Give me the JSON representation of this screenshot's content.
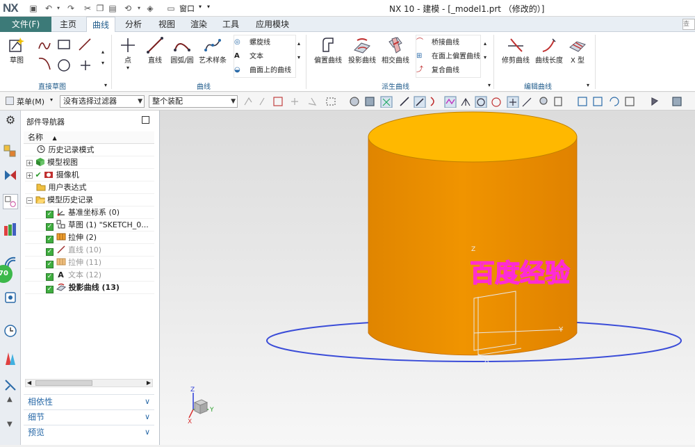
{
  "titlebar": {
    "logo": "NX",
    "window_title": "NX 10 - 建模 - [_model1.prt （修改的）]",
    "window_menu_label": "窗口"
  },
  "menubar": {
    "file_tab": "文件(F)",
    "tabs": [
      "主页",
      "曲线",
      "分析",
      "视图",
      "渲染",
      "工具",
      "应用模块"
    ],
    "active_tab": "曲线",
    "search_placeholder": "查找命令"
  },
  "ribbon": {
    "sketch_label": "草图",
    "direct_sketch_group": "直接草图",
    "curve_group": "曲线",
    "derived_curve_group": "派生曲线",
    "edit_curve_group": "编辑曲线",
    "curve_buttons": [
      "点",
      "直线",
      "圆弧/圆",
      "艺术样条"
    ],
    "curve_list": [
      "螺旋线",
      "文本",
      "曲面上的曲线"
    ],
    "derived_buttons": [
      "偏置曲线",
      "投影曲线",
      "相交曲线"
    ],
    "derived_list": [
      "桥接曲线",
      "在面上偏置曲线",
      "复合曲线"
    ],
    "edit_buttons": [
      "修剪曲线",
      "曲线长度",
      "X 型"
    ]
  },
  "toolbar": {
    "menu_label": "菜单(M)",
    "filter_value": "没有选择过滤器",
    "assembly_value": "整个装配"
  },
  "navigator": {
    "title": "部件导航器",
    "column_name": "名称",
    "items": [
      {
        "label": "历史记录模式"
      },
      {
        "label": "模型视图"
      },
      {
        "label": "摄像机"
      },
      {
        "label": "用户表达式"
      },
      {
        "label": "模型历史记录"
      },
      {
        "label": "基准坐标系 (0)"
      },
      {
        "label": "草图 (1) \"SKETCH_0..."
      },
      {
        "label": "拉伸 (2)"
      },
      {
        "label": "直线 (10)"
      },
      {
        "label": "拉伸 (11)"
      },
      {
        "label": "文本 (12)"
      },
      {
        "label": "投影曲线 (13)"
      }
    ],
    "sections": [
      "相依性",
      "细节",
      "预览"
    ]
  },
  "left_strip": {
    "badge": "70"
  },
  "viewport": {
    "embossed_text": "百度经验",
    "axis_labels": {
      "x": "X",
      "y": "Y",
      "z": "Z"
    },
    "cylinder_color": "#f09400",
    "top_color": "#ffb800",
    "text_color": "#ff2bd6"
  },
  "colors": {
    "accent": "#3c7a78",
    "link": "#2a6aa8"
  }
}
